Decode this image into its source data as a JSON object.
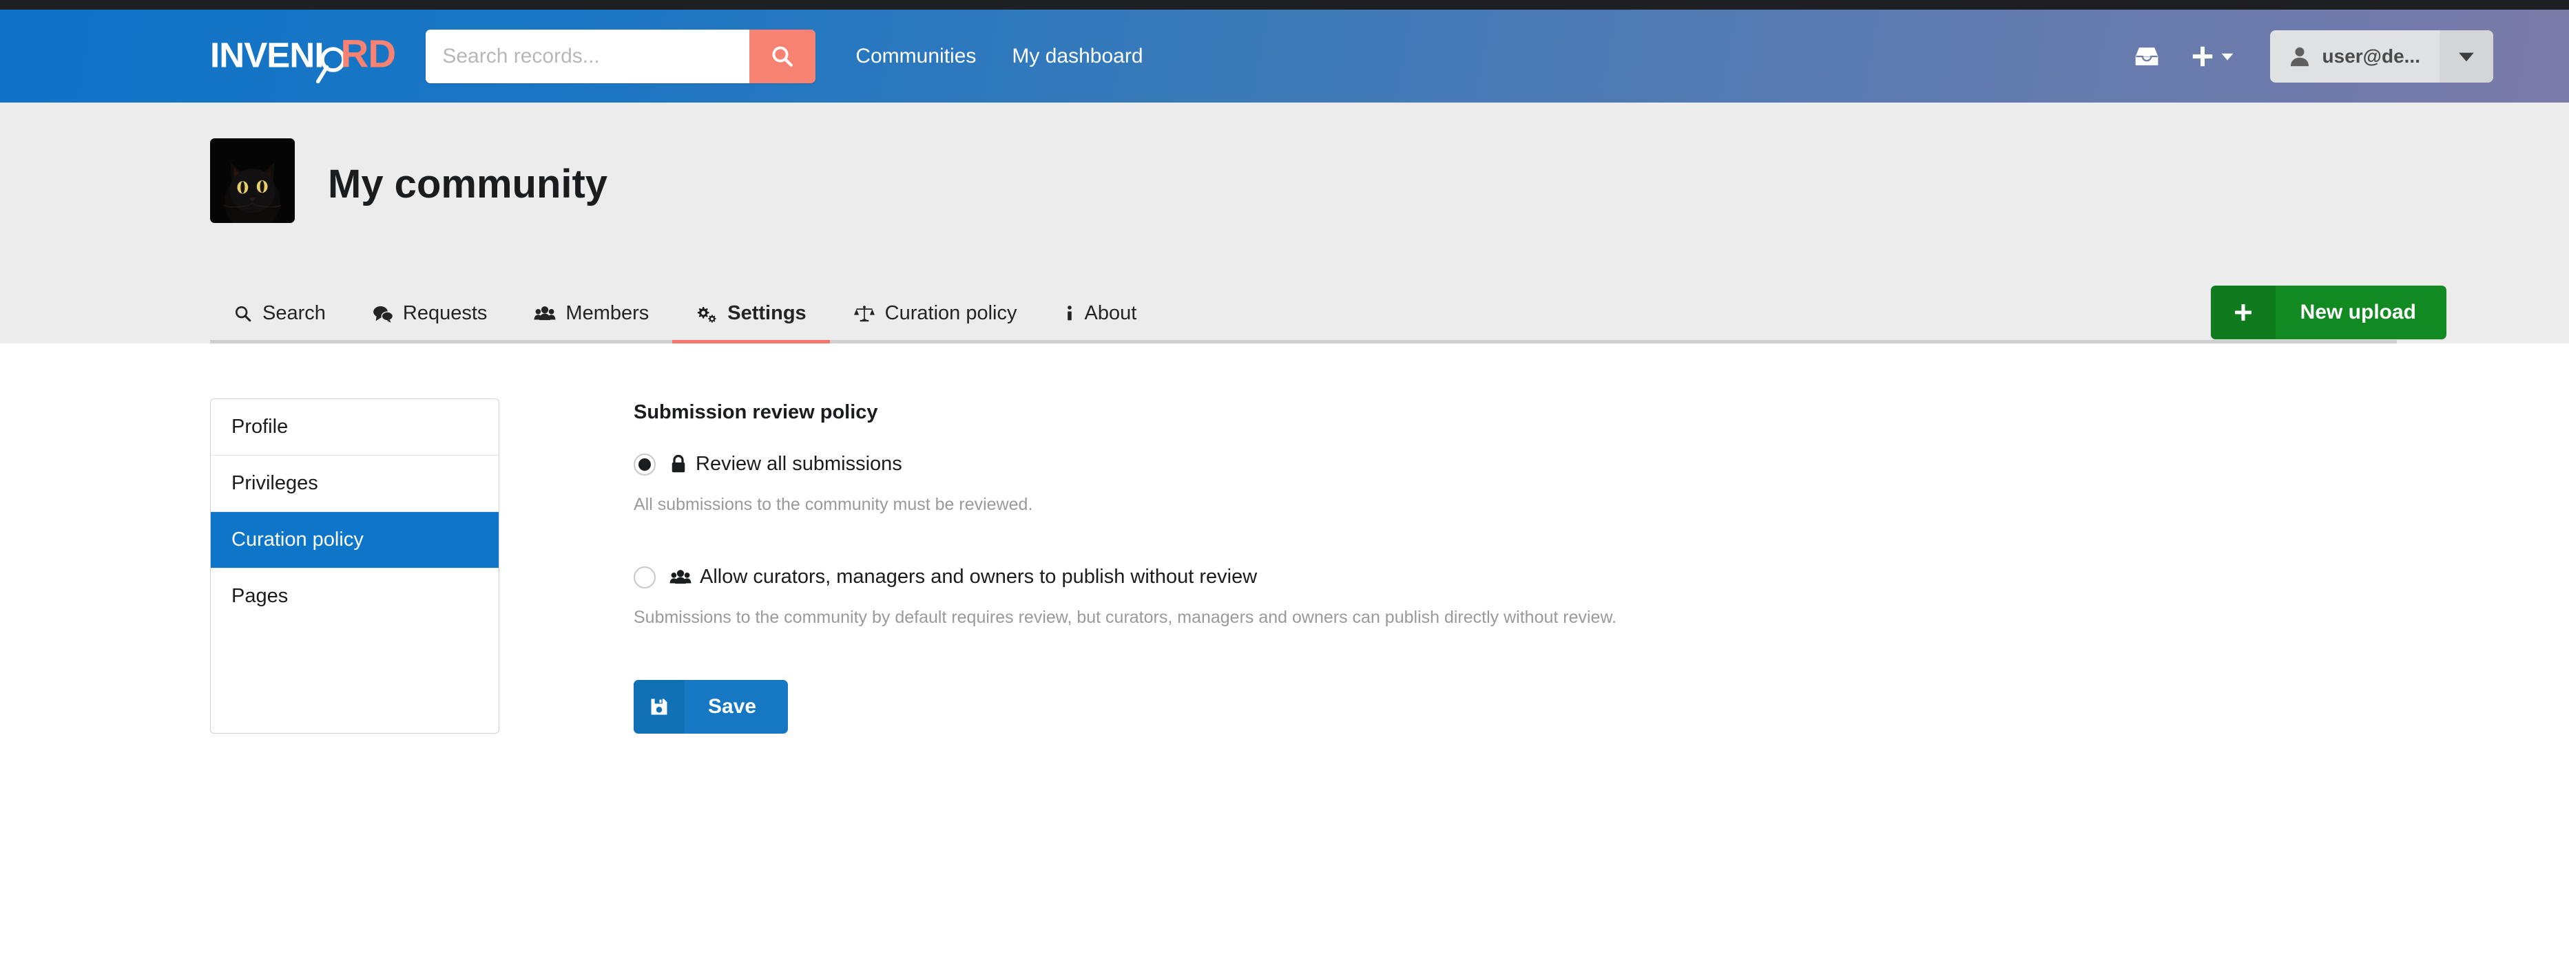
{
  "header": {
    "logo_text_primary": "INVENIO",
    "logo_text_accent": "RDM",
    "search": {
      "placeholder": "Search records...",
      "value": "",
      "button_icon": "search-icon"
    },
    "nav": [
      {
        "label": "Communities"
      },
      {
        "label": "My dashboard"
      }
    ],
    "icons": [
      {
        "name": "inbox-icon"
      },
      {
        "name": "plus-icon"
      },
      {
        "name": "chevron-down-icon"
      }
    ],
    "user": {
      "label": "user@de...",
      "avatar_icon": "user-icon",
      "caret_icon": "caret-down-icon"
    },
    "colors": {
      "gradient_start": "#1073c7",
      "gradient_end": "#7b7ba8",
      "accent": "#f78272"
    }
  },
  "community": {
    "title": "My community",
    "logo_alt": "black cat community logo",
    "new_upload": {
      "label": "New upload",
      "icon": "plus-icon",
      "color": "#128a22"
    },
    "tabs": [
      {
        "label": "Search",
        "icon": "search-icon",
        "active": false
      },
      {
        "label": "Requests",
        "icon": "comments-icon",
        "active": false
      },
      {
        "label": "Members",
        "icon": "users-icon",
        "active": false
      },
      {
        "label": "Settings",
        "icon": "cogs-icon",
        "active": true
      },
      {
        "label": "Curation policy",
        "icon": "balance-scale-icon",
        "active": false
      },
      {
        "label": "About",
        "icon": "info-icon",
        "active": false
      }
    ],
    "active_tab_color": "#f7776a"
  },
  "settings": {
    "menu": [
      {
        "label": "Profile",
        "active": false
      },
      {
        "label": "Privileges",
        "active": false
      },
      {
        "label": "Curation policy",
        "active": true
      },
      {
        "label": "Pages",
        "active": false
      }
    ],
    "active_menu_color": "#0e76c8",
    "section_title": "Submission review policy",
    "options": [
      {
        "label": "Review all submissions",
        "icon": "lock-icon",
        "selected": true,
        "help": "All submissions to the community must be reviewed."
      },
      {
        "label": "Allow curators, managers and owners to publish without review",
        "icon": "users-icon",
        "selected": false,
        "help": "Submissions to the community by default requires review, but curators, managers and owners can publish directly without review."
      }
    ],
    "save": {
      "label": "Save",
      "icon": "save-icon",
      "color": "#1678c2"
    }
  }
}
